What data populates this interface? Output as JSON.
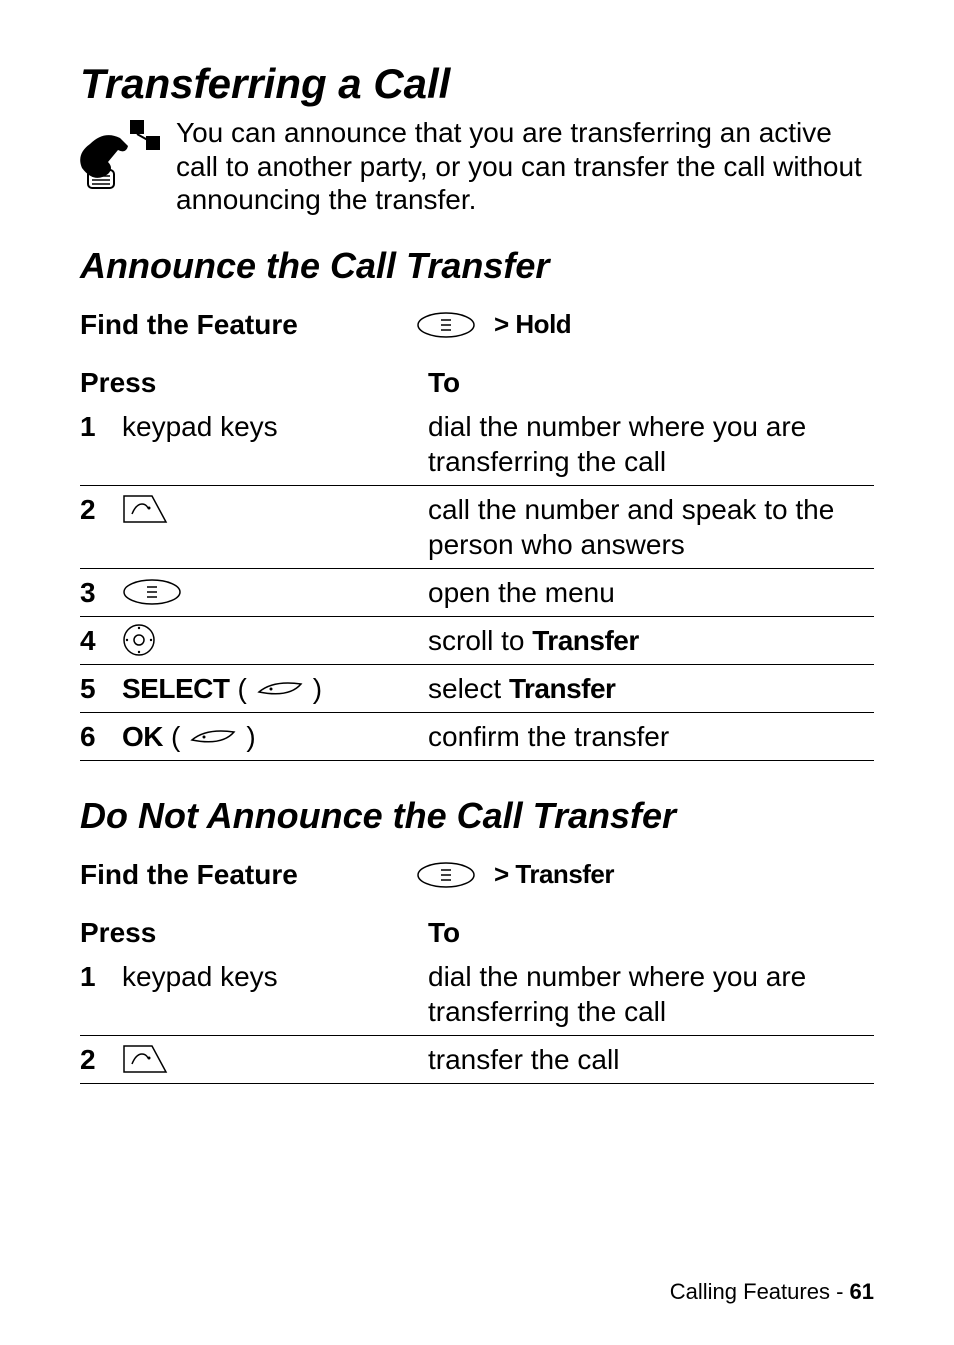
{
  "heading_main": "Transferring a Call",
  "intro": "You can announce that you are transferring an active call to another party, or you can transfer the call without announcing the transfer.",
  "section1": {
    "heading": "Announce the Call Transfer",
    "find_label": "Find the Feature",
    "find_value": "> Hold",
    "press_header": "Press",
    "to_header": "To",
    "rows": [
      {
        "num": "1",
        "press": "keypad keys",
        "to": "dial the number where you are transferring the call"
      },
      {
        "num": "2",
        "press_icon": "send",
        "to": "call the number and speak to the person who answers"
      },
      {
        "num": "3",
        "press_icon": "menu",
        "to": "open the menu"
      },
      {
        "num": "4",
        "press_icon": "nav",
        "to_prefix": "scroll to ",
        "to_bold": "Transfer"
      },
      {
        "num": "5",
        "press_bold": "SELECT",
        "press_suffix_icon": "softkey",
        "to_prefix": "select ",
        "to_bold": "Transfer"
      },
      {
        "num": "6",
        "press_bold": "OK",
        "press_suffix_icon": "softkey",
        "to": "confirm the transfer"
      }
    ]
  },
  "section2": {
    "heading": "Do Not Announce the Call Transfer",
    "find_label": "Find the Feature",
    "find_value": "> Transfer",
    "press_header": "Press",
    "to_header": "To",
    "rows": [
      {
        "num": "1",
        "press": "keypad keys",
        "to": "dial the number where you are transferring the call"
      },
      {
        "num": "2",
        "press_icon": "send",
        "to": "transfer the call"
      }
    ]
  },
  "footer_text": "Calling Features - ",
  "footer_page": "61"
}
